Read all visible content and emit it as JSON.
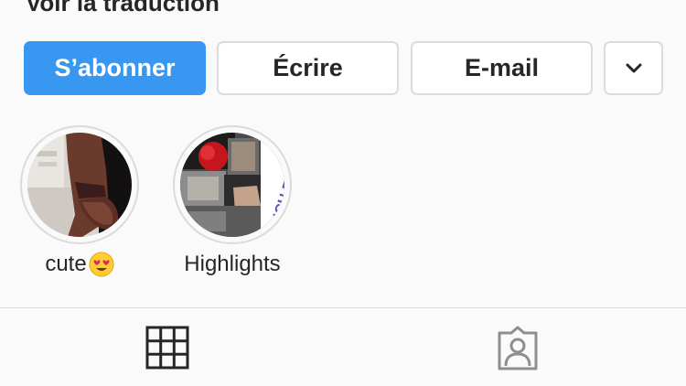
{
  "header": {
    "translate_link": "Voir la traduction"
  },
  "actions": {
    "follow_label": "S’abonner",
    "message_label": "Écrire",
    "email_label": "E-mail",
    "more_icon": "chevron-down-icon"
  },
  "highlights": [
    {
      "label": "cute",
      "emoji": "😍"
    },
    {
      "label": "Highlights",
      "overlay_text": "ENCH RIVEAIRA"
    }
  ],
  "tabs": [
    {
      "name": "grid",
      "icon": "grid-icon"
    },
    {
      "name": "tagged",
      "icon": "tagged-icon"
    }
  ],
  "colors": {
    "accent": "#3897f0",
    "border": "#dbdbdb",
    "text": "#262626",
    "background": "#fafafa"
  }
}
